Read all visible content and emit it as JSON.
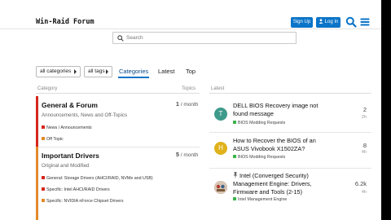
{
  "header": {
    "site_title": "Win-Raid Forum",
    "signup_label": "Sign Up",
    "login_label": "Log In"
  },
  "search": {
    "placeholder": "Search"
  },
  "nav": {
    "categories_filter": "all categories",
    "tags_filter": "all tags",
    "tabs": [
      {
        "label": "Categories",
        "active": true
      },
      {
        "label": "Latest",
        "active": false
      },
      {
        "label": "Top",
        "active": false
      }
    ]
  },
  "categories_table": {
    "col_category": "Category",
    "col_topics": "Topics",
    "rows": [
      {
        "name": "General & Forum",
        "description": "Announcements, News and Off-Topics",
        "count": "1",
        "period": "/ month",
        "color": "#d6261c",
        "subcategories": [
          {
            "label": "News / Announcements",
            "color": "#d6261c"
          },
          {
            "label": "Off Topic",
            "color": "#e28a2a"
          }
        ]
      },
      {
        "name": "Important Drivers",
        "description": "Original and Modified",
        "count": "5",
        "period": "/ month",
        "color": "#e28a2a",
        "subcategories": [
          {
            "label": "General: Storage Drivers (AHCI/RAID, NVMe and USB)",
            "color": "#d6261c"
          },
          {
            "label": "Specific: Intel AHCI/RAID Drivers",
            "color": "#d6261c"
          },
          {
            "label": "Specific: NVIDIA nForce Chipset Drivers",
            "color": "#e28a2a"
          }
        ]
      }
    ]
  },
  "latest": {
    "heading": "Latest",
    "topics": [
      {
        "avatar_letter": "T",
        "avatar_color": "#3e9a8a",
        "title": "DELL BIOS Recovery image not found message",
        "category": "BIOS Modding Requests",
        "count": "2",
        "age": "2h"
      },
      {
        "avatar_letter": "H",
        "avatar_color": "#e0b21a",
        "title": "How to Recover the BIOS of an ASUS Vivobook X1502ZA?",
        "category": "BIOS Modding Requests",
        "count": "8",
        "age": "4h"
      },
      {
        "avatar_letter": "",
        "avatar_color": "#c94a3a",
        "pin_icon": "pin-icon",
        "title": "Intel (Converged Security) Management Engine: Drivers, Firmware and Tools (2-15)",
        "category": "Intel Management Engine",
        "count": "6.2k",
        "age": "4h"
      }
    ]
  },
  "colors": {
    "accent": "#0a74c8",
    "category_green": "#3ab54a"
  }
}
